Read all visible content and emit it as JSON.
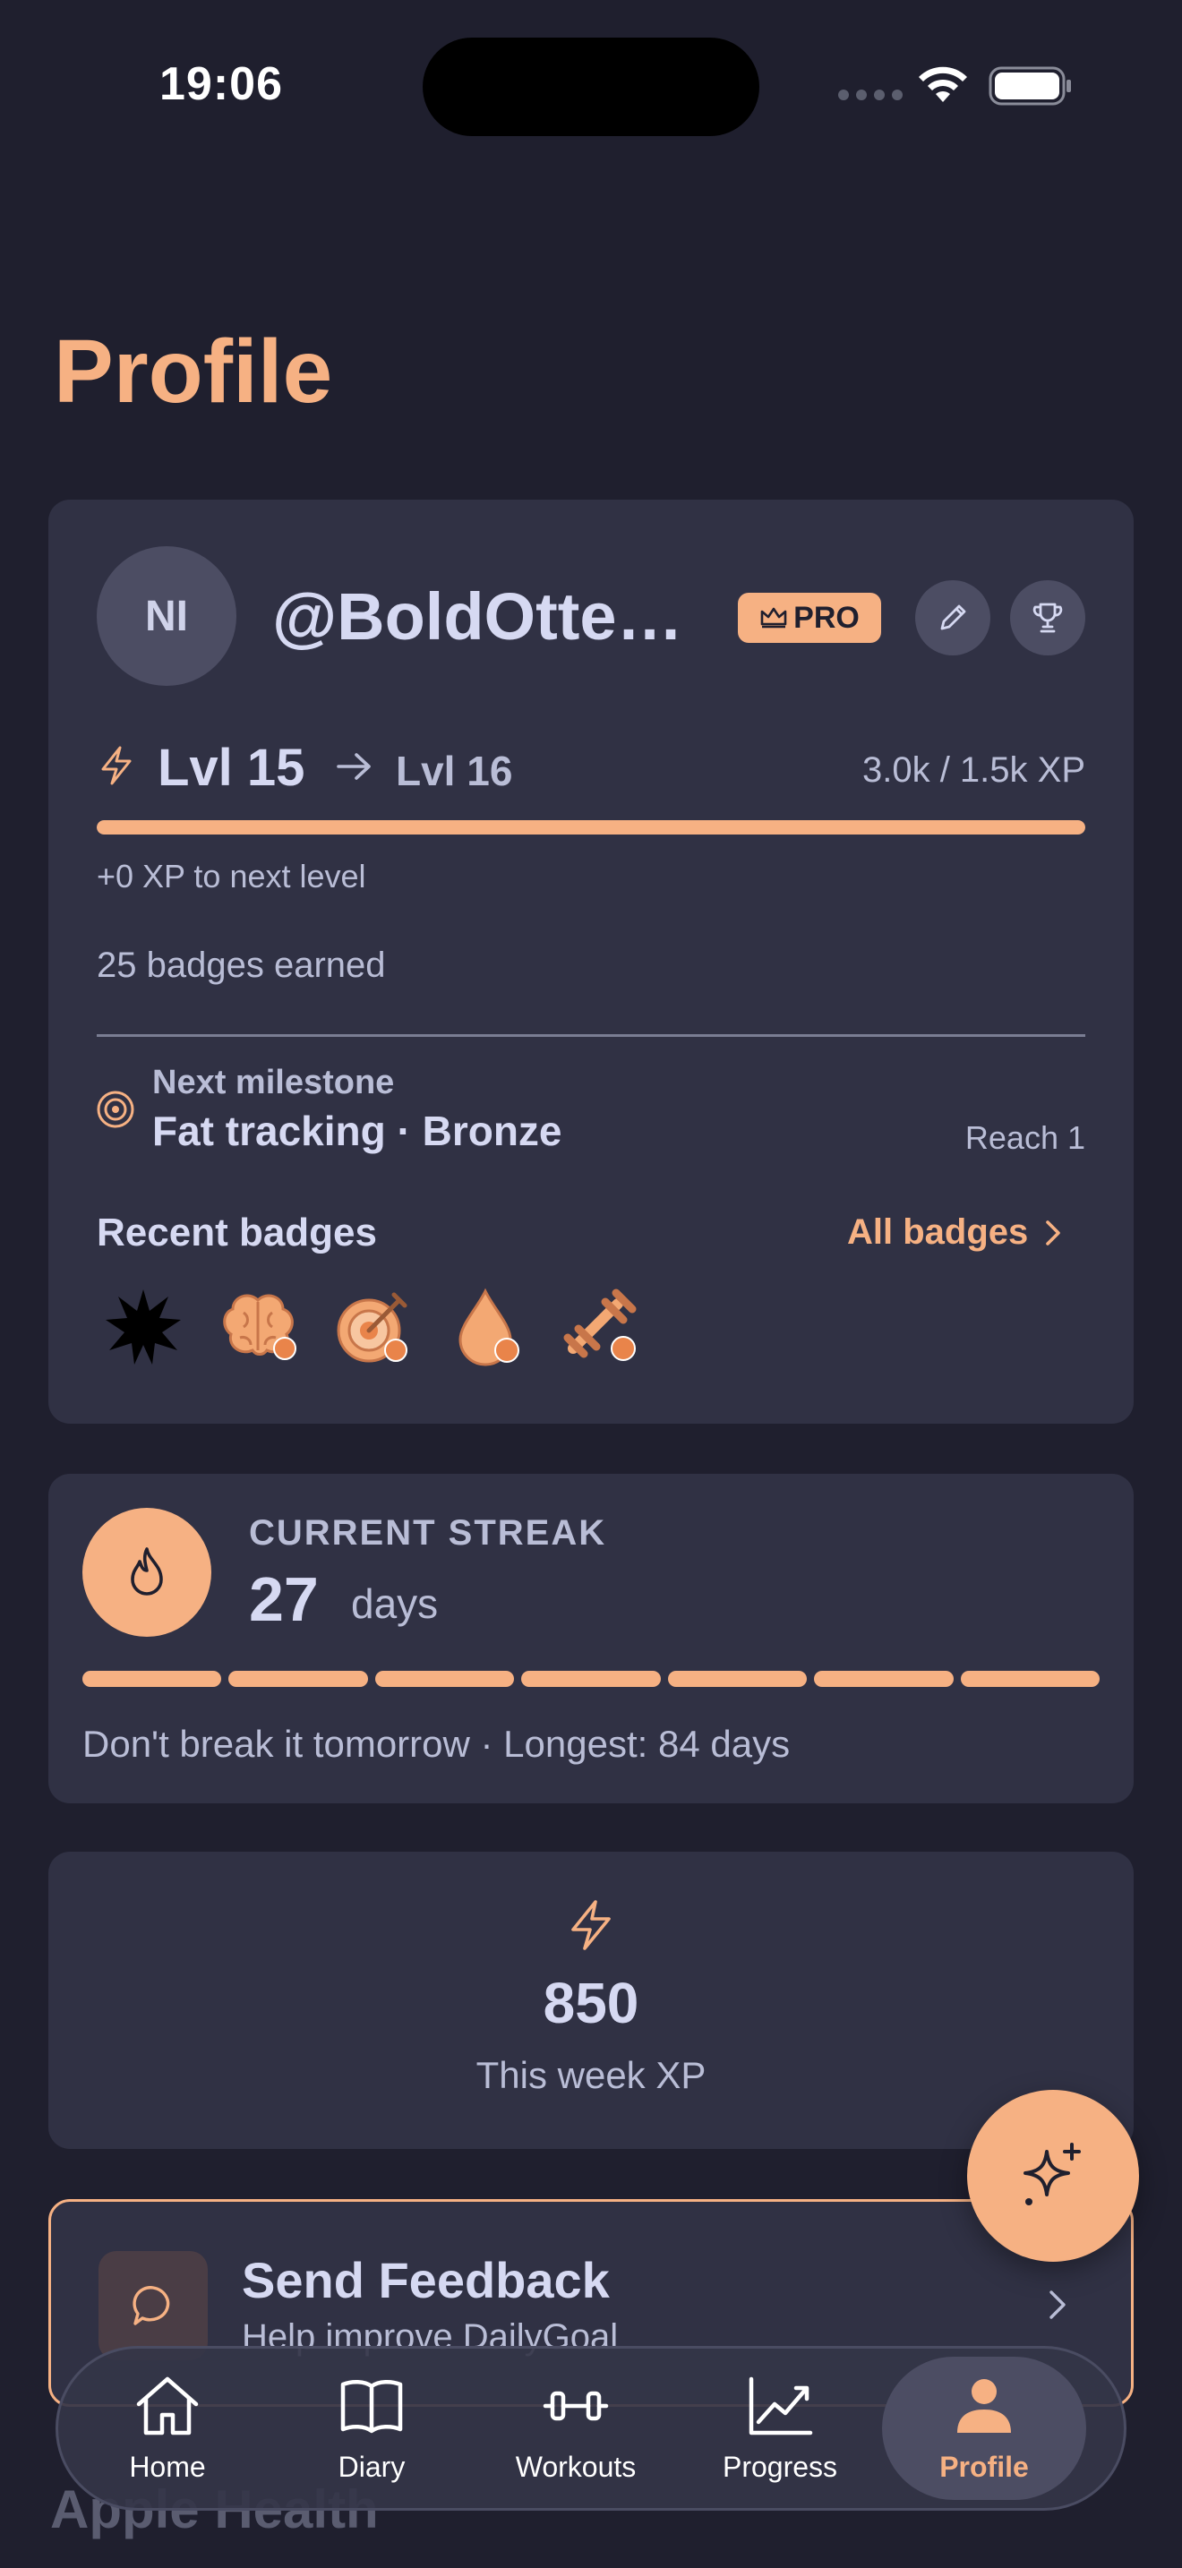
{
  "status": {
    "time": "19:06"
  },
  "page": {
    "title": "Profile"
  },
  "profile": {
    "initials": "NI",
    "username": "@BoldOtter…",
    "pro_label": "PRO",
    "level_current": "Lvl 15",
    "level_next": "Lvl 16",
    "xp_ratio": "3.0k / 1.5k XP",
    "xp_progress_fraction": 1.0,
    "xp_to_next": "+0 XP to next level",
    "badges_earned": "25 badges earned",
    "milestone": {
      "label": "Next milestone",
      "name": "Fat tracking · Bronze",
      "reach": "Reach 1"
    },
    "recent_badges_label": "Recent badges",
    "all_badges_label": "All badges",
    "recent_badges": [
      "star-burst-badge",
      "brain-badge",
      "target-badge",
      "drop-badge",
      "dumbbell-badge"
    ]
  },
  "streak": {
    "label": "CURRENT STREAK",
    "value": "27",
    "unit": "days",
    "segments_filled": 7,
    "segments_total": 7,
    "note": "Don't break it tomorrow · Longest: 84 days"
  },
  "week_xp": {
    "value": "850",
    "label": "This week XP"
  },
  "feedback": {
    "title": "Send Feedback",
    "subtitle": "Help improve DailyGoal"
  },
  "next_section": {
    "title": "Apple Health"
  },
  "tabs": [
    {
      "label": "Home",
      "icon": "home-icon"
    },
    {
      "label": "Diary",
      "icon": "book-icon"
    },
    {
      "label": "Workouts",
      "icon": "dumbbell-icon"
    },
    {
      "label": "Progress",
      "icon": "chart-icon"
    },
    {
      "label": "Profile",
      "icon": "person-icon",
      "active": true
    }
  ],
  "colors": {
    "background": "#1f1f2e",
    "card": "#303144",
    "accent": "#f6b183",
    "text": "#d6d9f2",
    "muted": "#b9bdd6"
  }
}
